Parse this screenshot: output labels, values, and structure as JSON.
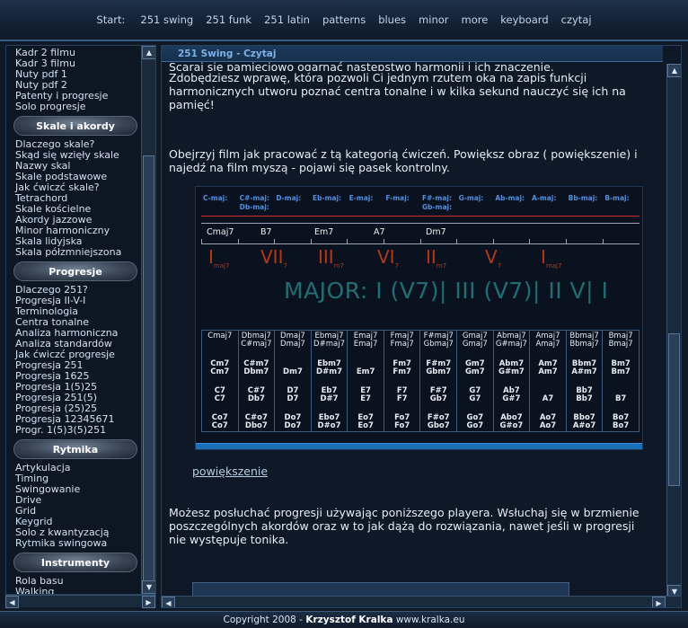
{
  "nav": {
    "start_label": "Start:",
    "items": [
      "251 swing",
      "251 funk",
      "251 latin",
      "patterns",
      "blues",
      "minor",
      "more",
      "keyboard",
      "czytaj"
    ]
  },
  "sidebar": {
    "group0": [
      "Kadr 2 filmu",
      "Kadr 3 filmu",
      "Nuty pdf 1",
      "Nuty pdf 2",
      "Patenty i progresje",
      "Solo progresje"
    ],
    "head1": "Skale i akordy",
    "group1": [
      "Dlaczego skale?",
      "Skąd się wzięły skale",
      "Nazwy skal",
      "Skale podstawowe",
      "Jak ćwiczć skale?",
      "Tetrachord",
      "Skale kościelne",
      "Akordy jazzowe",
      "Minor harmoniczny",
      "Skala lidyjska",
      "Skala półzmniejszona"
    ],
    "head2": "Progresje",
    "group2": [
      "Dlaczego 251?",
      "Progresja II-V-I",
      "Terminologia",
      "Centra tonalne",
      "Analiza harmoniczna",
      "Analiza standardów",
      "Jak ćwiczć progresje",
      "Progresja 251",
      "Progresja 1625",
      "Progresja 1(5)25",
      "Progresja 251(5)",
      "Progresja (25)25",
      "Progresja 12345671",
      "Progr. 1(5)3(5)251"
    ],
    "head3": "Rytmika",
    "group3": [
      "Artykulacja",
      "Timing",
      "Swingowanie",
      "Drive",
      "Grid",
      "Keygrid",
      "Solo z kwantyzacją",
      "Rytmika swingowa"
    ],
    "head4": "Instrumenty",
    "group4": [
      "Rola basu",
      "Walking"
    ]
  },
  "main": {
    "title": "251 Swing - Czytaj",
    "para1_line0": "Scaraj się pamięciowo ogarnąć następstwo harmonii i ich znaczenie.",
    "para1": "Zdobędziesz wprawę, która pozwoli Ci jednym rzutem oka na zapis funkcji harmonicznych utworu poznać centra tonalne i w kilka sekund nauczyć się ich na pamięć!",
    "para2": "Obejrzyj film jak pracować z tą kategorią ćwiczeń. Powiększ obraz ( powiększenie) i najedź na film myszą - pojawi się pasek kontrolny.",
    "enlarge_link": "powiększenie",
    "para3": "Możesz posłuchać progresji używając poniższego playera. Wsłuchaj się w brzmienie poszczególnych akordów oraz w to jak dążą do rozwiązania, nawet jeśli w progresji nie występuje tonika."
  },
  "video": {
    "keys": [
      {
        "l1": "C-maj:",
        "l2": ""
      },
      {
        "l1": "C#-maj:",
        "l2": "Db-maj:"
      },
      {
        "l1": "D-maj:",
        "l2": ""
      },
      {
        "l1": "Eb-maj:",
        "l2": ""
      },
      {
        "l1": "E-maj:",
        "l2": ""
      },
      {
        "l1": "F-maj:",
        "l2": ""
      },
      {
        "l1": "F#-maj:",
        "l2": "Gb-maj:"
      },
      {
        "l1": "G-maj:",
        "l2": ""
      },
      {
        "l1": "Ab-maj:",
        "l2": ""
      },
      {
        "l1": "A-maj:",
        "l2": ""
      },
      {
        "l1": "Bb-maj:",
        "l2": ""
      },
      {
        "l1": "B-maj:",
        "l2": ""
      }
    ],
    "chords": [
      "Cmaj7",
      "B7",
      "Em7",
      "A7",
      "Dm7"
    ],
    "romans": [
      {
        "n": "I",
        "s": "maj7"
      },
      {
        "n": "VII",
        "s": "7"
      },
      {
        "n": "III",
        "s": "m7"
      },
      {
        "n": "VI",
        "s": "7"
      },
      {
        "n": "II",
        "s": "m7"
      },
      {
        "n": "V",
        "s": "7"
      },
      {
        "n": "I",
        "s": "maj7"
      }
    ],
    "major_text": "MAJOR: I (V7)| III (V7)| II V| I",
    "grid": [
      [
        "Cmaj7",
        "",
        "Cm7",
        "Cm7",
        "C7",
        "C7",
        "Co7",
        "Co7"
      ],
      [
        "Dbmaj7",
        "C#maj7",
        "C#m7",
        "Dbm7",
        "C#7",
        "Db7",
        "C#o7",
        "Dbo7"
      ],
      [
        "Dmaj7",
        "Dmaj7",
        "",
        "Dm7",
        "D7",
        "D7",
        "Do7",
        "Do7"
      ],
      [
        "Ebmaj7",
        "D#maj7",
        "Ebm7",
        "D#m7",
        "Eb7",
        "D#7",
        "Ebo7",
        "D#o7"
      ],
      [
        "Emaj7",
        "Emaj7",
        "",
        "Em7",
        "E7",
        "E7",
        "Eo7",
        "Eo7"
      ],
      [
        "Fmaj7",
        "Fmaj7",
        "Fm7",
        "Fm7",
        "F7",
        "F7",
        "Fo7",
        "Fo7"
      ],
      [
        "F#maj7",
        "Gbmaj7",
        "F#m7",
        "Gbm7",
        "F#7",
        "Gb7",
        "F#o7",
        "Gbo7"
      ],
      [
        "Gmaj7",
        "Gmaj7",
        "Gm7",
        "Gm7",
        "G7",
        "G7",
        "Go7",
        "Go7"
      ],
      [
        "Abmaj7",
        "G#maj7",
        "Abm7",
        "G#m7",
        "Ab7",
        "G#7",
        "Abo7",
        "G#o7"
      ],
      [
        "Amaj7",
        "Amaj7",
        "Am7",
        "Am7",
        "",
        "A7",
        "Ao7",
        "Ao7"
      ],
      [
        "Bbmaj7",
        "Bbmaj7",
        "Bbm7",
        "A#m7",
        "Bb7",
        "Bb7",
        "Bbo7",
        "A#o7"
      ],
      [
        "Bmaj7",
        "Bmaj7",
        "Bm7",
        "Bm7",
        "",
        "B7",
        "Bo7",
        "Bo7"
      ]
    ]
  },
  "footer": {
    "copyright": "Copyright 2008 - ",
    "author": "Krzysztof Kralka",
    "site": " www.kralka.eu"
  },
  "colors": {
    "accent": "#7bb1e6",
    "roman_red": "#b23818",
    "major_teal": "#1f6f72"
  }
}
